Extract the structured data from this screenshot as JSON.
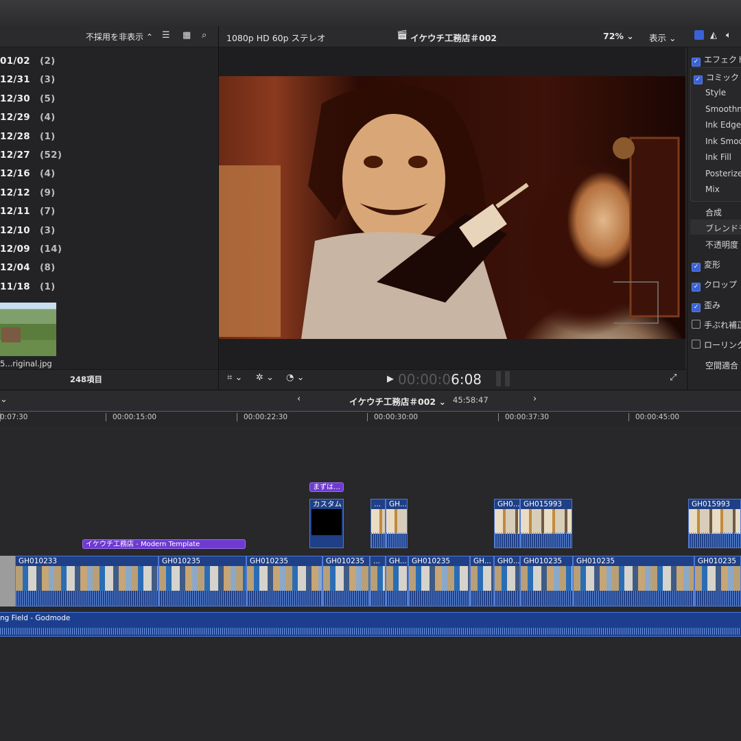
{
  "browser": {
    "filter_label": "不採用を非表示 ⌃",
    "date_groups": [
      {
        "date": "01/02",
        "count": "(2)"
      },
      {
        "date": "12/31",
        "count": "(3)"
      },
      {
        "date": "12/30",
        "count": "(5)"
      },
      {
        "date": "12/29",
        "count": "(4)"
      },
      {
        "date": "12/28",
        "count": "(1)"
      },
      {
        "date": "12/27",
        "count": "(52)"
      },
      {
        "date": "12/16",
        "count": "(4)"
      },
      {
        "date": "12/12",
        "count": "(9)"
      },
      {
        "date": "12/11",
        "count": "(7)"
      },
      {
        "date": "12/10",
        "count": "(3)"
      },
      {
        "date": "12/09",
        "count": "(14)"
      },
      {
        "date": "12/04",
        "count": "(8)"
      },
      {
        "date": "11/18",
        "count": "(1)"
      }
    ],
    "thumb_label": "5...riginal.jpg",
    "item_count": "248項目"
  },
  "viewer": {
    "format": "1080p HD 60p ステレオ",
    "project": "イケウチ工務店＃002",
    "zoom": "72%",
    "view_menu": "表示",
    "timecode_dim": "00:00:0",
    "timecode_bright": "6:08"
  },
  "inspector": {
    "effects_header": "エフェクト",
    "comic": "コミック (",
    "params": [
      "Style",
      "Smoothne",
      "Ink Edges",
      "Ink Smoot",
      "Ink Fill",
      "Posterize",
      "Mix"
    ],
    "composite": "合成",
    "blend": "ブレンドモ",
    "opacity": "不透明度",
    "transform": "変形",
    "crop": "クロップ",
    "distort": "歪み",
    "stabilize": "手ぶれ補正",
    "rolling": "ローリング",
    "spatial": "空間適合"
  },
  "timeline": {
    "project": "イケウチ工務店＃002",
    "duration": "45:58:47",
    "ruler": [
      {
        "label": "0:07:30"
      },
      {
        "label": "00:00:15:00"
      },
      {
        "label": "00:00:22:30"
      },
      {
        "label": "00:00:30:00"
      },
      {
        "label": "00:00:37:30"
      },
      {
        "label": "00:00:45:00"
      }
    ],
    "title_clip": "まずは…",
    "custom_clip": "カスタム",
    "template_clip": "イケウチ工務店 - Modern Template",
    "upper_clips": [
      "...",
      "GH...",
      "GH0...",
      "GH015993",
      "GH015993"
    ],
    "main_clips": [
      "GH010233",
      "GH010235",
      "GH010235",
      "GH010235",
      "...",
      "GH...",
      "GH010235",
      "GH...",
      "GH0...",
      "GH010235",
      "GH010235",
      "GH010235"
    ],
    "audio_clip": "ng Field - Godmode"
  },
  "colors": {
    "accent": "#3a62d6",
    "clip_blue": "#1f3f86",
    "title_purple": "#6e3ad1"
  }
}
